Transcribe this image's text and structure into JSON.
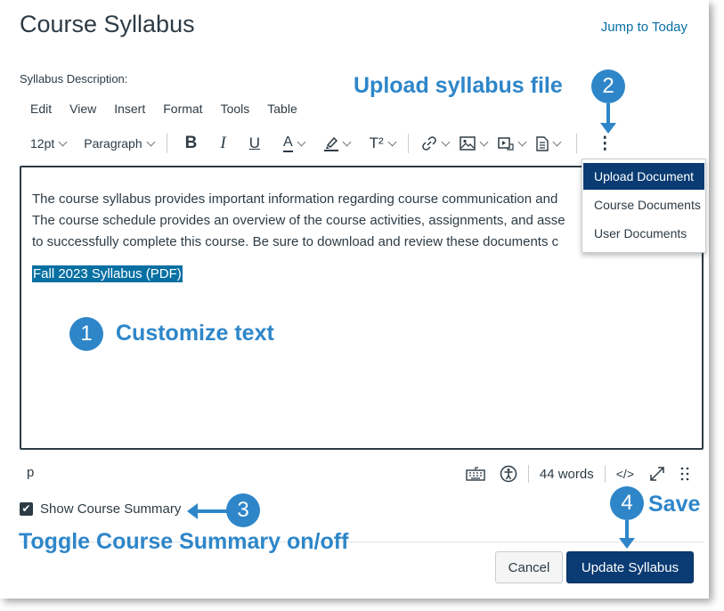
{
  "page": {
    "title": "Course Syllabus",
    "jump_link": "Jump to Today",
    "description_label": "Syllabus Description:"
  },
  "menubar": [
    "Edit",
    "View",
    "Insert",
    "Format",
    "Tools",
    "Table"
  ],
  "toolbar": {
    "font_size": "12pt",
    "block_format": "Paragraph",
    "bold": "B",
    "italic": "I",
    "underline": "U",
    "text_color": "A",
    "superscript": "T²",
    "more": "⋮"
  },
  "editor": {
    "lines": [
      "The course syllabus provides important information regarding course communication and",
      "The course schedule provides an overview of the course activities, assignments, and asse",
      "to successfully complete this course. Be sure to download and review these documents c"
    ],
    "link_text": "Fall 2023 Syllabus (PDF)"
  },
  "document_menu": {
    "options": [
      "Upload Document",
      "Course Documents",
      "User Documents"
    ],
    "active_index": 0
  },
  "status_bar": {
    "path": "p",
    "word_count": "44 words",
    "html_toggle": "</>"
  },
  "options": {
    "show_summary_label": "Show Course Summary",
    "show_summary_checked": true
  },
  "actions": {
    "cancel": "Cancel",
    "submit": "Update Syllabus"
  },
  "annotations": {
    "step1_num": "1",
    "step1_label": "Customize text",
    "step2_num": "2",
    "step2_label": "Upload syllabus file",
    "step3_num": "3",
    "step3_label": "Toggle Course Summary on/off",
    "step4_num": "4",
    "step4_label": "Save"
  },
  "colors": {
    "annotation": "#2e86c9",
    "primary": "#0a3b73",
    "link": "#0770a3",
    "text": "#2d3b45"
  }
}
